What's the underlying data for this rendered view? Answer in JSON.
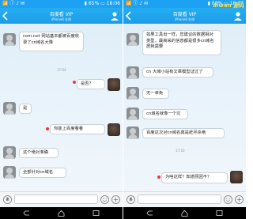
{
  "left": {
    "status": {
      "left": "📶 ⓘ ♪ ✉",
      "battery": "65%",
      "time": "18:06"
    },
    "title": {
      "name": "百度看 VIP",
      "sub": "iPhone6 在线"
    },
    "messages": [
      {
        "text": "com.net 网站基本都被百度收录了cn域名大降"
      },
      {
        "text": "是否？"
      },
      {
        "text": "是"
      },
      {
        "text": "你能上百度看看"
      },
      {
        "text": "这个绝对准确"
      },
      {
        "text": "全部针对cn域名"
      }
    ],
    "timestamp": "17:04",
    "input_placeholder": ""
  },
  "right": {
    "status": {
      "left": "📶 ⓘ ♪ ✉",
      "battery": "68%",
      "time": "18:07"
    },
    "title": {
      "name": "百度看 VIP",
      "sub": "iPhone6 在线"
    },
    "messages": [
      {
        "text": "如果工具出一样，您建议的数据相对类型，最高采的信息都是很多cn域名居我需要"
      },
      {
        "text": "cn 大域小站有文章模型证过了"
      },
      {
        "text": "无一幸免"
      },
      {
        "text": "cn域名就像一个坑"
      },
      {
        "text": "百度这次对cn域名真是赶尽杀绝"
      },
      {
        "text": "为啥这样？知道原因不？"
      }
    ],
    "timestamp": "17:10",
    "watermark": "aiwan 源码",
    "input_placeholder": ""
  }
}
